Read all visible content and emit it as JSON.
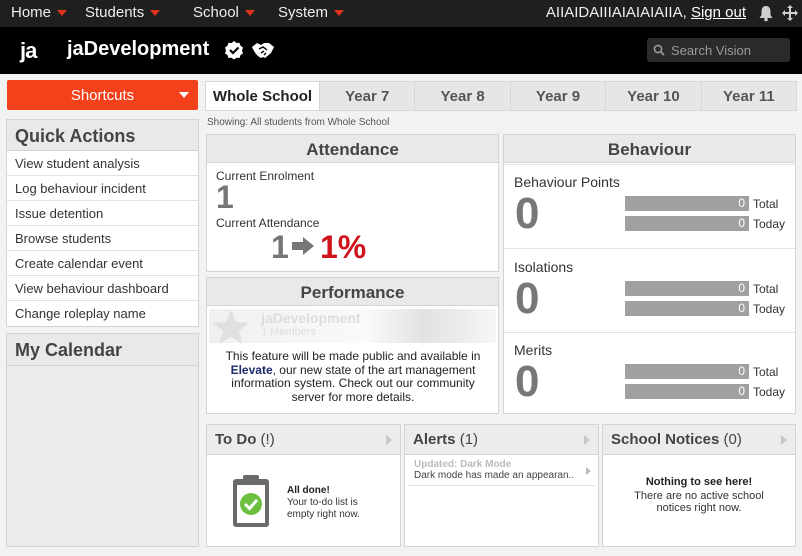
{
  "topnav": {
    "items": [
      {
        "label": "Home"
      },
      {
        "label": "Students"
      },
      {
        "label": "School"
      },
      {
        "label": "System"
      }
    ],
    "username": "AIIAIDAIIIAIAIAIAIIA,",
    "signout_label": "Sign out",
    "bell_icon": "bell-icon",
    "move_icon": "move-icon"
  },
  "header": {
    "logo": "ja",
    "brand": "jaDevelopment",
    "verified_icon": "verified-badge-icon",
    "partner_icon": "handshake-icon",
    "search_placeholder": "Search Vision"
  },
  "shortcuts": {
    "label": "Shortcuts"
  },
  "quick_actions": {
    "title": "Quick Actions",
    "items": [
      {
        "label": "View student analysis"
      },
      {
        "label": "Log behaviour incident"
      },
      {
        "label": "Issue detention"
      },
      {
        "label": "Browse students"
      },
      {
        "label": "Create calendar event"
      },
      {
        "label": "View behaviour dashboard"
      },
      {
        "label": "Change roleplay name"
      }
    ]
  },
  "calendar": {
    "title": "My Calendar"
  },
  "tabs": [
    {
      "label": "Whole School",
      "active": true
    },
    {
      "label": "Year 7"
    },
    {
      "label": "Year 8"
    },
    {
      "label": "Year 9"
    },
    {
      "label": "Year 10"
    },
    {
      "label": "Year 11"
    }
  ],
  "showing": "Showing: All students from Whole School",
  "attendance": {
    "title": "Attendance",
    "enrolment_label": "Current Enrolment",
    "enrolment_value": "1",
    "attendance_label": "Current Attendance",
    "attendance_count": "1",
    "attendance_percent": "1%",
    "percent_color": "#d0131b"
  },
  "performance": {
    "title": "Performance",
    "card_name": "jaDevelopment",
    "card_members": "1 Members",
    "note_pre": "This feature will be made public and available in ",
    "note_bold": "Elevate",
    "note_post": ", our new state of the art management information system. Check out our community server for more details."
  },
  "behaviour": {
    "title": "Behaviour",
    "rows": [
      {
        "label": "Behaviour Points",
        "value": "0",
        "total": "0",
        "today": "0"
      },
      {
        "label": "Isolations",
        "value": "0",
        "total": "0",
        "today": "0"
      },
      {
        "label": "Merits",
        "value": "0",
        "total": "0",
        "today": "0"
      }
    ],
    "total_label": "Total",
    "today_label": "Today"
  },
  "todo": {
    "title": "To Do",
    "count": "(!)",
    "done_title": "All done!",
    "done_text": "Your to-do list is empty right now.",
    "icon": "clipboard-check-icon"
  },
  "alerts": {
    "title": "Alerts",
    "count": "(1)",
    "items": [
      {
        "title": "Updated: Dark Mode",
        "desc": "Dark mode has made an appearan.."
      }
    ]
  },
  "notices": {
    "title": "School Notices",
    "count": "(0)",
    "empty_title": "Nothing to see here!",
    "empty_text": "There are no active school notices right now."
  },
  "colors": {
    "accent": "#f2411b",
    "header_bg": "#000000",
    "nav_bg": "#1f1f1f"
  }
}
